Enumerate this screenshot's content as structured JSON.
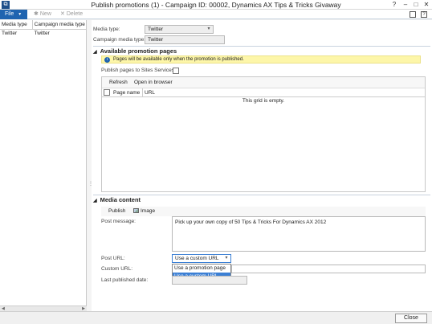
{
  "window": {
    "app_icon": "app-logo-icon",
    "title": "Publish promotions (1) - Campaign ID: 00002, Dynamics AX Tips & Tricks Givaway",
    "help_label": "?",
    "minimize_label": "–",
    "maximize_label": "□",
    "close_label": "✕"
  },
  "toolbar": {
    "file_label": "File",
    "new_label": "New",
    "delete_label": "Delete"
  },
  "left_grid": {
    "columns": [
      "Media type",
      "Campaign media type"
    ],
    "rows": [
      [
        "Twitter",
        "Twitter"
      ]
    ]
  },
  "header_fields": {
    "media_type_label": "Media type:",
    "media_type_value": "Twitter",
    "campaign_media_type_label": "Campaign media type:",
    "campaign_media_type_value": "Twitter"
  },
  "promotion_pages": {
    "title": "Available promotion pages",
    "info_message": "Pages will be available only when the promotion is published.",
    "publish_sites_label": "Publish pages to Sites Services:",
    "refresh_label": "Refresh",
    "open_browser_label": "Open in browser",
    "columns": [
      "Page name",
      "URL"
    ],
    "empty_text": "This grid is empty."
  },
  "media_content": {
    "title": "Media content",
    "publish_label": "Publish",
    "image_label": "Image",
    "post_message_label": "Post message:",
    "post_message_value": "Pick up your own copy of 50 Tips & Tricks For Dynamics AX 2012",
    "post_url_label": "Post URL:",
    "post_url_value": "Use a custom URL",
    "custom_url_label": "Custom URL:",
    "last_published_label": "Last published date:",
    "url_options": [
      "Use a promotion page",
      "Use a custom URL"
    ],
    "selected_option_index": 1
  },
  "footer": {
    "close_label": "Close"
  }
}
